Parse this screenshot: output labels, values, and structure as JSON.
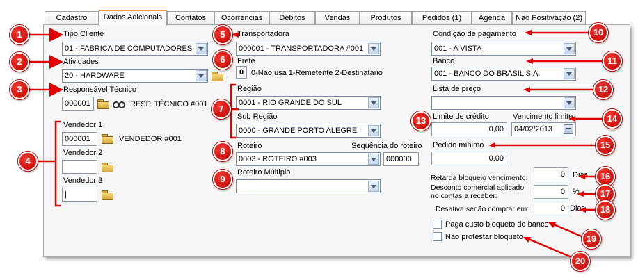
{
  "tabs": [
    {
      "label": "Cadastro"
    },
    {
      "label": "Dados Adicionais"
    },
    {
      "label": "Contatos"
    },
    {
      "label": "Ocorrencias"
    },
    {
      "label": "Débitos"
    },
    {
      "label": "Vendas"
    },
    {
      "label": "Produtos"
    },
    {
      "label": "Pedidos (1)"
    },
    {
      "label": "Agenda"
    },
    {
      "label": "Não Positivação (2)"
    }
  ],
  "left": {
    "tipo_cliente": {
      "label": "Tipo Cliente",
      "value": "01 - FABRICA DE COMPUTADORES"
    },
    "atividades": {
      "label": "Atividades",
      "value": "20 - HARDWARE"
    },
    "responsavel": {
      "label": "Responsável Técnico",
      "code": "000001",
      "name": "RESP. TÉCNICO #001"
    },
    "vendedor1": {
      "label": "Vendedor 1",
      "code": "000001",
      "name": "VENDEDOR #001"
    },
    "vendedor2": {
      "label": "Vendedor 2",
      "code": ""
    },
    "vendedor3": {
      "label": "Vendedor 3",
      "code": "|"
    }
  },
  "middle": {
    "transportadora": {
      "label": "Transportadora",
      "value": "000001 - TRANSPORTADORA #001"
    },
    "frete": {
      "label": "Frete",
      "value": "0",
      "options": "0-Não usa  1-Remetente  2-Destinatário"
    },
    "regiao": {
      "label": "Região",
      "value": "0001 - RIO GRANDE DO SUL"
    },
    "sub_regiao": {
      "label": "Sub Região",
      "value": "0000 - GRANDE PORTO ALEGRE"
    },
    "roteiro": {
      "label": "Roteiro",
      "value": "0003 - ROTEIRO #003",
      "seq_label": "Sequência do roteiro",
      "seq_value": "000000"
    },
    "roteiro_multiplo": {
      "label": "Roteiro Múltiplo",
      "value": ""
    }
  },
  "right": {
    "condicao_pagamento": {
      "label": "Condição de pagamento",
      "value": "001 - A VISTA"
    },
    "banco": {
      "label": "Banco",
      "value": "001 - BANCO DO BRASIL S.A."
    },
    "lista_preco": {
      "label": "Lista de preço",
      "value": ""
    },
    "limite_credito": {
      "label": "Limite de crédito",
      "value": "0,00"
    },
    "vencimento_limite": {
      "label": "Vencimento limite",
      "value": "04/02/2013"
    },
    "pedido_minimo": {
      "label": "Pedido mínimo",
      "value": "0,00"
    },
    "retarda_bloqueio": {
      "label": "Retarda bloqueio vencimento:",
      "value": "0",
      "unit": "Dias"
    },
    "desconto_comercial": {
      "label_line1": "Desconto comercial aplicado",
      "label_line2": "no contas a receber:",
      "value": "0",
      "unit": "%"
    },
    "desativa_senao": {
      "label": "Desativa senão comprar em:",
      "value": "0",
      "unit": "Dias"
    },
    "paga_custo": {
      "label": "Paga custo bloqueto do banco",
      "checked": false
    },
    "nao_protestar": {
      "label": "Não protestar bloqueto",
      "checked": false
    }
  },
  "markers": [
    "1",
    "2",
    "3",
    "4",
    "5",
    "6",
    "7",
    "8",
    "9",
    "10",
    "11",
    "12",
    "13",
    "14",
    "15",
    "16",
    "17",
    "18",
    "19",
    "20"
  ],
  "colors": {
    "marker": "#d00000",
    "arrow": "#e00000",
    "active_tab_accent": "#e8a13a",
    "field_border": "#7a8ea8"
  }
}
